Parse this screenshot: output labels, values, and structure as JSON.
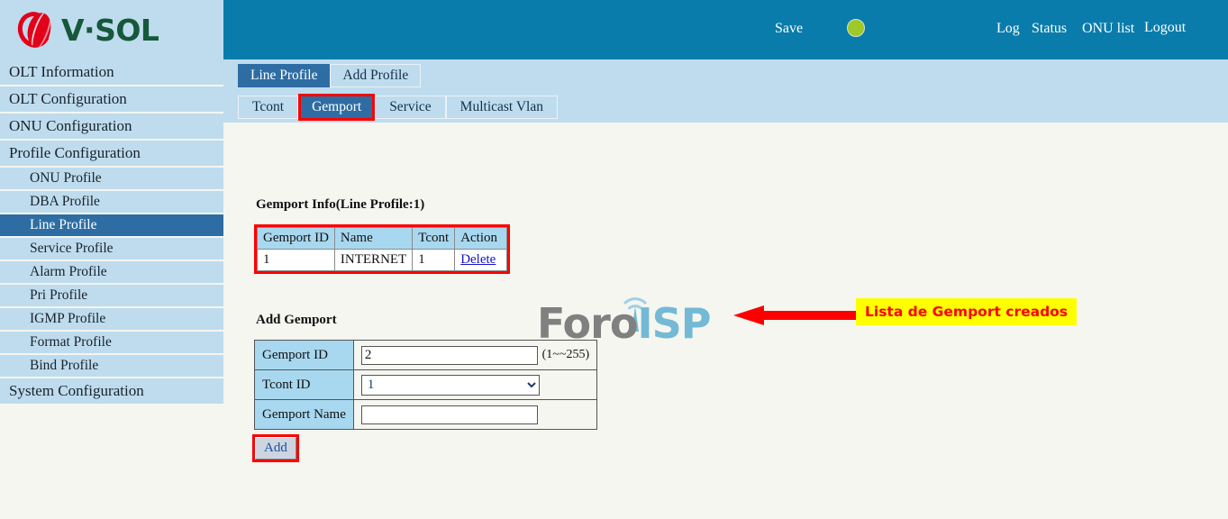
{
  "brand": {
    "name": "V·SOL",
    "logo_icon": "vsol-logo-icon"
  },
  "header": {
    "save_label": "Save",
    "status_dot_color": "#9fc828",
    "links": [
      {
        "label": "Log"
      },
      {
        "label": "Status"
      },
      {
        "label": "ONU list"
      },
      {
        "label": "Logout"
      }
    ]
  },
  "sidebar": {
    "items": [
      {
        "label": "OLT Information",
        "level": "top",
        "active": false
      },
      {
        "label": "OLT Configuration",
        "level": "top",
        "active": false
      },
      {
        "label": "ONU Configuration",
        "level": "top",
        "active": false
      },
      {
        "label": "Profile Configuration",
        "level": "top",
        "active": false
      },
      {
        "label": "ONU Profile",
        "level": "sub",
        "active": false
      },
      {
        "label": "DBA Profile",
        "level": "sub",
        "active": false
      },
      {
        "label": "Line Profile",
        "level": "sub",
        "active": true
      },
      {
        "label": "Service Profile",
        "level": "sub",
        "active": false
      },
      {
        "label": "Alarm Profile",
        "level": "sub",
        "active": false
      },
      {
        "label": "Pri Profile",
        "level": "sub",
        "active": false
      },
      {
        "label": "IGMP Profile",
        "level": "sub",
        "active": false
      },
      {
        "label": "Format Profile",
        "level": "sub",
        "active": false
      },
      {
        "label": "Bind Profile",
        "level": "sub",
        "active": false
      },
      {
        "label": "System Configuration",
        "level": "top",
        "active": false
      }
    ]
  },
  "tabs_primary": [
    {
      "label": "Line Profile",
      "active": true
    },
    {
      "label": "Add Profile",
      "active": false
    }
  ],
  "tabs_secondary": [
    {
      "label": "Tcont",
      "active": false
    },
    {
      "label": "Gemport",
      "active": true
    },
    {
      "label": "Service",
      "active": false
    },
    {
      "label": "Multicast Vlan",
      "active": false
    }
  ],
  "gemport_info": {
    "title": "Gemport Info(Line Profile:1)",
    "columns": [
      "Gemport ID",
      "Name",
      "Tcont",
      "Action"
    ],
    "rows": [
      {
        "gemport_id": "1",
        "name": "INTERNET",
        "tcont": "1",
        "action": "Delete"
      }
    ]
  },
  "annotation": {
    "text": "Lista de Gemport creados",
    "text_color": "#fc0000",
    "background_color": "#ffff00",
    "arrow_color": "#fc0000",
    "arrow_icon": "left-arrow-icon"
  },
  "watermark": {
    "part1": "Foro",
    "part2": "ISP",
    "icon": "antenna-tower-icon"
  },
  "add_gemport": {
    "title": "Add Gemport",
    "fields": {
      "gemport_id": {
        "label": "Gemport ID",
        "value": "2",
        "placeholder": "",
        "hint": "(1~~255)"
      },
      "tcont_id": {
        "label": "Tcont ID",
        "value": "1",
        "options": [
          "1"
        ]
      },
      "gemport_name": {
        "label": "Gemport Name",
        "value": "",
        "placeholder": ""
      }
    },
    "add_button": "Add"
  }
}
